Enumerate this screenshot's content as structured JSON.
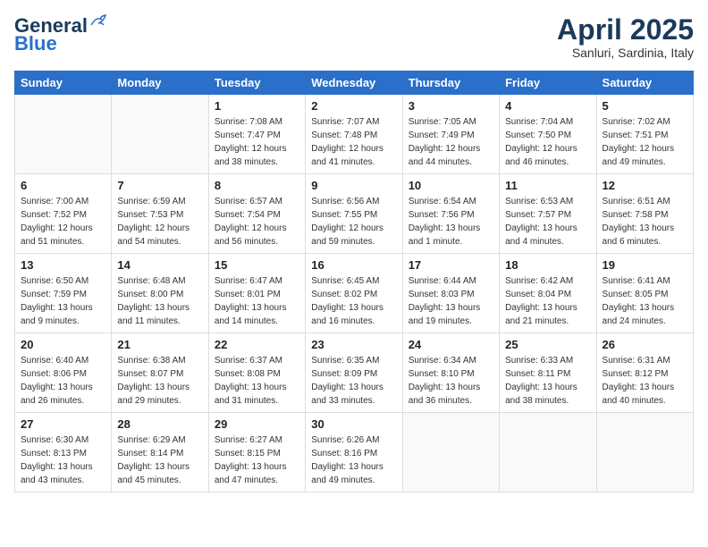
{
  "header": {
    "logo_line1": "General",
    "logo_line2": "Blue",
    "month": "April 2025",
    "location": "Sanluri, Sardinia, Italy"
  },
  "weekdays": [
    "Sunday",
    "Monday",
    "Tuesday",
    "Wednesday",
    "Thursday",
    "Friday",
    "Saturday"
  ],
  "weeks": [
    [
      {
        "day": "",
        "info": ""
      },
      {
        "day": "",
        "info": ""
      },
      {
        "day": "1",
        "info": "Sunrise: 7:08 AM\nSunset: 7:47 PM\nDaylight: 12 hours\nand 38 minutes."
      },
      {
        "day": "2",
        "info": "Sunrise: 7:07 AM\nSunset: 7:48 PM\nDaylight: 12 hours\nand 41 minutes."
      },
      {
        "day": "3",
        "info": "Sunrise: 7:05 AM\nSunset: 7:49 PM\nDaylight: 12 hours\nand 44 minutes."
      },
      {
        "day": "4",
        "info": "Sunrise: 7:04 AM\nSunset: 7:50 PM\nDaylight: 12 hours\nand 46 minutes."
      },
      {
        "day": "5",
        "info": "Sunrise: 7:02 AM\nSunset: 7:51 PM\nDaylight: 12 hours\nand 49 minutes."
      }
    ],
    [
      {
        "day": "6",
        "info": "Sunrise: 7:00 AM\nSunset: 7:52 PM\nDaylight: 12 hours\nand 51 minutes."
      },
      {
        "day": "7",
        "info": "Sunrise: 6:59 AM\nSunset: 7:53 PM\nDaylight: 12 hours\nand 54 minutes."
      },
      {
        "day": "8",
        "info": "Sunrise: 6:57 AM\nSunset: 7:54 PM\nDaylight: 12 hours\nand 56 minutes."
      },
      {
        "day": "9",
        "info": "Sunrise: 6:56 AM\nSunset: 7:55 PM\nDaylight: 12 hours\nand 59 minutes."
      },
      {
        "day": "10",
        "info": "Sunrise: 6:54 AM\nSunset: 7:56 PM\nDaylight: 13 hours\nand 1 minute."
      },
      {
        "day": "11",
        "info": "Sunrise: 6:53 AM\nSunset: 7:57 PM\nDaylight: 13 hours\nand 4 minutes."
      },
      {
        "day": "12",
        "info": "Sunrise: 6:51 AM\nSunset: 7:58 PM\nDaylight: 13 hours\nand 6 minutes."
      }
    ],
    [
      {
        "day": "13",
        "info": "Sunrise: 6:50 AM\nSunset: 7:59 PM\nDaylight: 13 hours\nand 9 minutes."
      },
      {
        "day": "14",
        "info": "Sunrise: 6:48 AM\nSunset: 8:00 PM\nDaylight: 13 hours\nand 11 minutes."
      },
      {
        "day": "15",
        "info": "Sunrise: 6:47 AM\nSunset: 8:01 PM\nDaylight: 13 hours\nand 14 minutes."
      },
      {
        "day": "16",
        "info": "Sunrise: 6:45 AM\nSunset: 8:02 PM\nDaylight: 13 hours\nand 16 minutes."
      },
      {
        "day": "17",
        "info": "Sunrise: 6:44 AM\nSunset: 8:03 PM\nDaylight: 13 hours\nand 19 minutes."
      },
      {
        "day": "18",
        "info": "Sunrise: 6:42 AM\nSunset: 8:04 PM\nDaylight: 13 hours\nand 21 minutes."
      },
      {
        "day": "19",
        "info": "Sunrise: 6:41 AM\nSunset: 8:05 PM\nDaylight: 13 hours\nand 24 minutes."
      }
    ],
    [
      {
        "day": "20",
        "info": "Sunrise: 6:40 AM\nSunset: 8:06 PM\nDaylight: 13 hours\nand 26 minutes."
      },
      {
        "day": "21",
        "info": "Sunrise: 6:38 AM\nSunset: 8:07 PM\nDaylight: 13 hours\nand 29 minutes."
      },
      {
        "day": "22",
        "info": "Sunrise: 6:37 AM\nSunset: 8:08 PM\nDaylight: 13 hours\nand 31 minutes."
      },
      {
        "day": "23",
        "info": "Sunrise: 6:35 AM\nSunset: 8:09 PM\nDaylight: 13 hours\nand 33 minutes."
      },
      {
        "day": "24",
        "info": "Sunrise: 6:34 AM\nSunset: 8:10 PM\nDaylight: 13 hours\nand 36 minutes."
      },
      {
        "day": "25",
        "info": "Sunrise: 6:33 AM\nSunset: 8:11 PM\nDaylight: 13 hours\nand 38 minutes."
      },
      {
        "day": "26",
        "info": "Sunrise: 6:31 AM\nSunset: 8:12 PM\nDaylight: 13 hours\nand 40 minutes."
      }
    ],
    [
      {
        "day": "27",
        "info": "Sunrise: 6:30 AM\nSunset: 8:13 PM\nDaylight: 13 hours\nand 43 minutes."
      },
      {
        "day": "28",
        "info": "Sunrise: 6:29 AM\nSunset: 8:14 PM\nDaylight: 13 hours\nand 45 minutes."
      },
      {
        "day": "29",
        "info": "Sunrise: 6:27 AM\nSunset: 8:15 PM\nDaylight: 13 hours\nand 47 minutes."
      },
      {
        "day": "30",
        "info": "Sunrise: 6:26 AM\nSunset: 8:16 PM\nDaylight: 13 hours\nand 49 minutes."
      },
      {
        "day": "",
        "info": ""
      },
      {
        "day": "",
        "info": ""
      },
      {
        "day": "",
        "info": ""
      }
    ]
  ]
}
